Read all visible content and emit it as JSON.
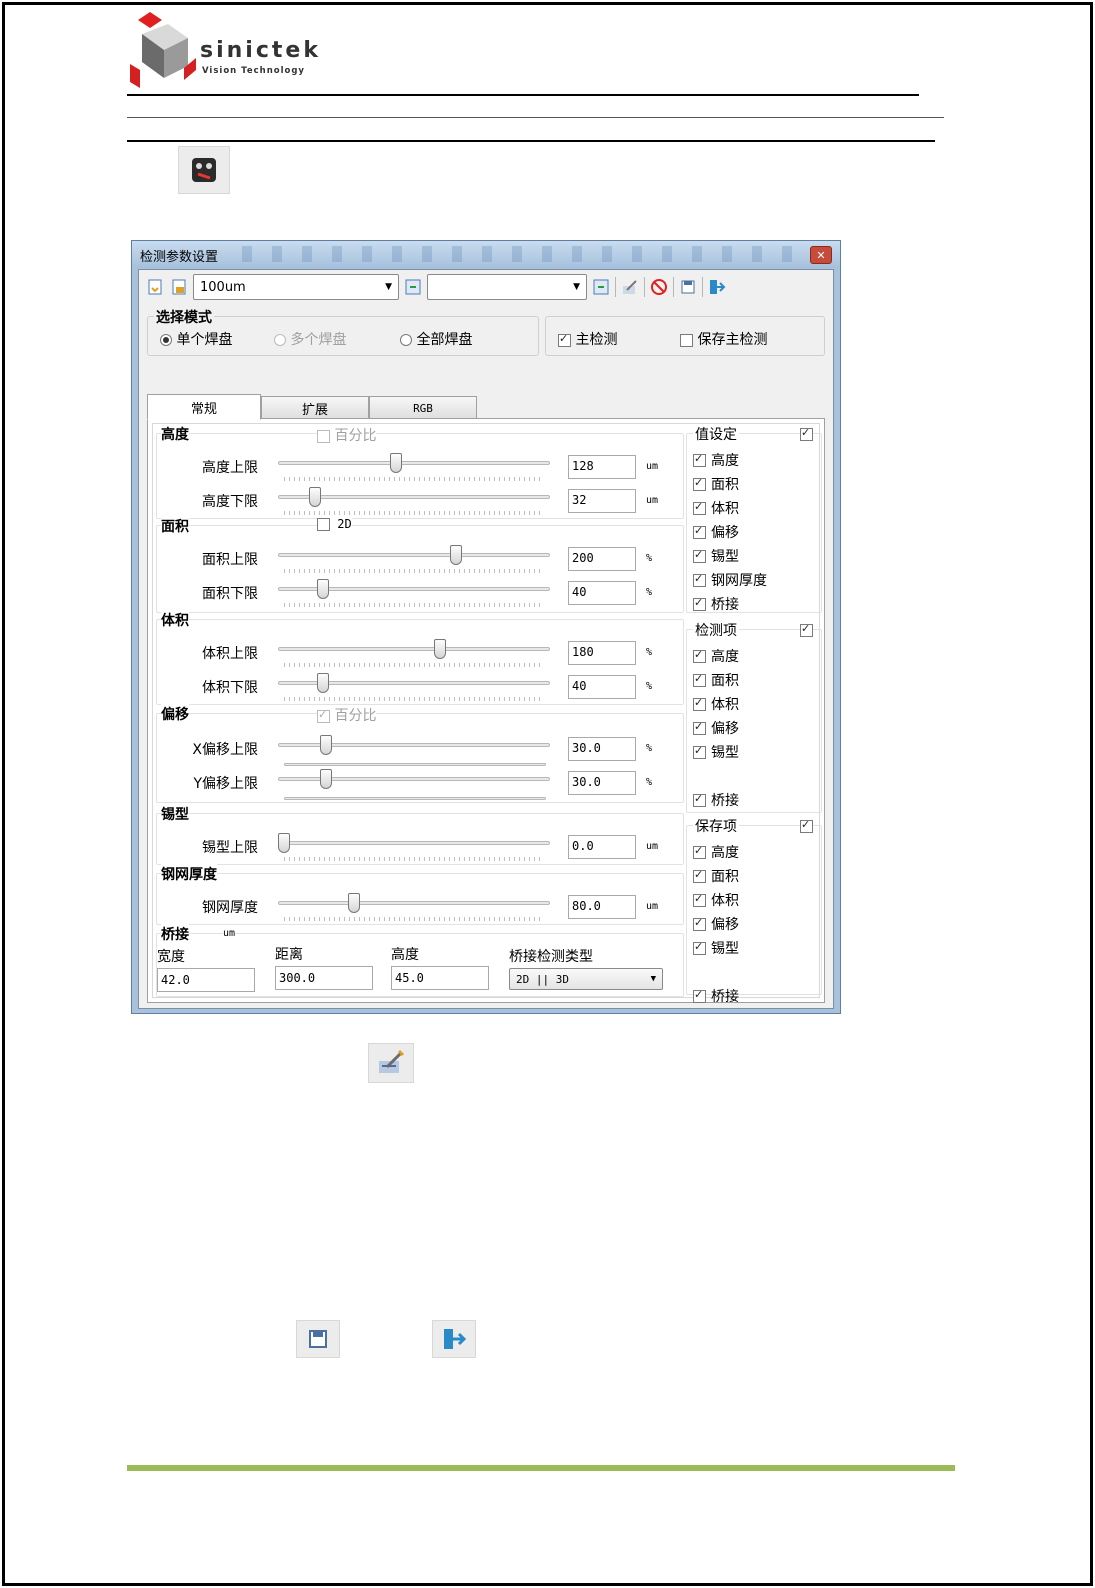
{
  "header": {
    "brand_name": "sinictek",
    "brand_tagline": "Vision Technology"
  },
  "dialog": {
    "title": "检测参数设置",
    "close_glyph": "✕",
    "toolbar": {
      "combo1_value": "100um",
      "combo2_value": ""
    },
    "mode": {
      "title": "选择模式",
      "options": [
        "单个焊盘",
        "多个焊盘",
        "全部焊盘"
      ],
      "main_check": "主检测",
      "save_main_check": "保存主检测"
    },
    "tabs": [
      "常规",
      "扩展",
      "RGB"
    ],
    "sections": {
      "height": {
        "title": "高度",
        "option": "百分比",
        "rows": [
          {
            "label": "高度上限",
            "value": "128",
            "unit": "um",
            "level": 0.43
          },
          {
            "label": "高度下限",
            "value": "32",
            "unit": "um",
            "level": 0.12
          }
        ]
      },
      "area": {
        "title": "面积",
        "option": "2D",
        "rows": [
          {
            "label": "面积上限",
            "value": "200",
            "unit": "%",
            "level": 0.66
          },
          {
            "label": "面积下限",
            "value": "40",
            "unit": "%",
            "level": 0.15
          }
        ]
      },
      "volume": {
        "title": "体积",
        "rows": [
          {
            "label": "体积上限",
            "value": "180",
            "unit": "%",
            "level": 0.6
          },
          {
            "label": "体积下限",
            "value": "40",
            "unit": "%",
            "level": 0.15
          }
        ]
      },
      "offset": {
        "title": "偏移",
        "option": "百分比",
        "rows": [
          {
            "label": "X偏移上限",
            "value": "30.0",
            "unit": "%",
            "level": 0.16
          },
          {
            "label": "Y偏移上限",
            "value": "30.0",
            "unit": "%",
            "level": 0.16
          }
        ]
      },
      "solder": {
        "title": "锡型",
        "rows": [
          {
            "label": "锡型上限",
            "value": "0.0",
            "unit": "um",
            "level": 0.0
          }
        ]
      },
      "stencil": {
        "title": "钢网厚度",
        "rows": [
          {
            "label": "钢网厚度",
            "value": "80.0",
            "unit": "um",
            "level": 0.27
          }
        ]
      },
      "bridge": {
        "title": "桥接",
        "unit": "um",
        "width_label": "宽度",
        "width_value": "42.0",
        "distance_label": "距离",
        "distance_value": "300.0",
        "height_label": "高度",
        "height_value": "45.0",
        "type_label": "桥接检测类型",
        "type_value": "2D || 3D"
      }
    },
    "right_groups": [
      {
        "title": "值设定",
        "items": [
          "高度",
          "面积",
          "体积",
          "偏移",
          "锡型",
          "钢网厚度",
          "桥接"
        ]
      },
      {
        "title": "检测项",
        "items": [
          "高度",
          "面积",
          "体积",
          "偏移",
          "锡型",
          "桥接"
        ]
      },
      {
        "title": "保存项",
        "items": [
          "高度",
          "面积",
          "体积",
          "偏移",
          "锡型",
          "桥接"
        ]
      }
    ]
  },
  "colors": {
    "footer_rule": "#9bbb59",
    "dialog_frame": "#a8c2dc"
  }
}
